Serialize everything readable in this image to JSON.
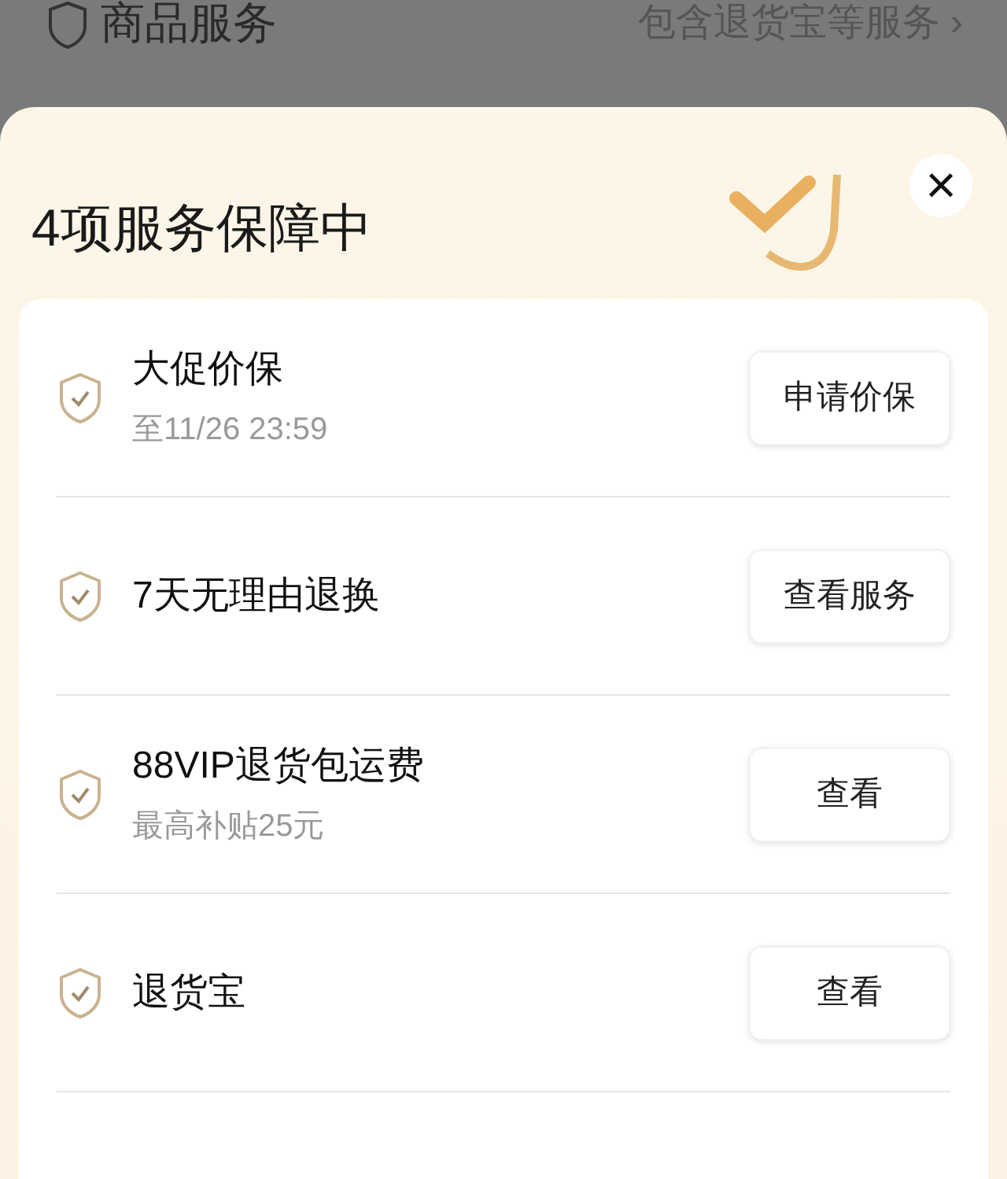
{
  "page_row": {
    "title": "商品服务",
    "summary": "包含退货宝等服务",
    "chevron": "›"
  },
  "sheet": {
    "title": "4项服务保障中",
    "close": "×"
  },
  "services": [
    {
      "name": "大促价保",
      "note": "至11/26 23:59",
      "action": "申请价保"
    },
    {
      "name": "7天无理由退换",
      "action": "查看服务"
    },
    {
      "name": "88VIP退货包运费",
      "note": "最高补贴25元",
      "action": "查看"
    },
    {
      "name": "退货宝",
      "action": "查看"
    }
  ]
}
